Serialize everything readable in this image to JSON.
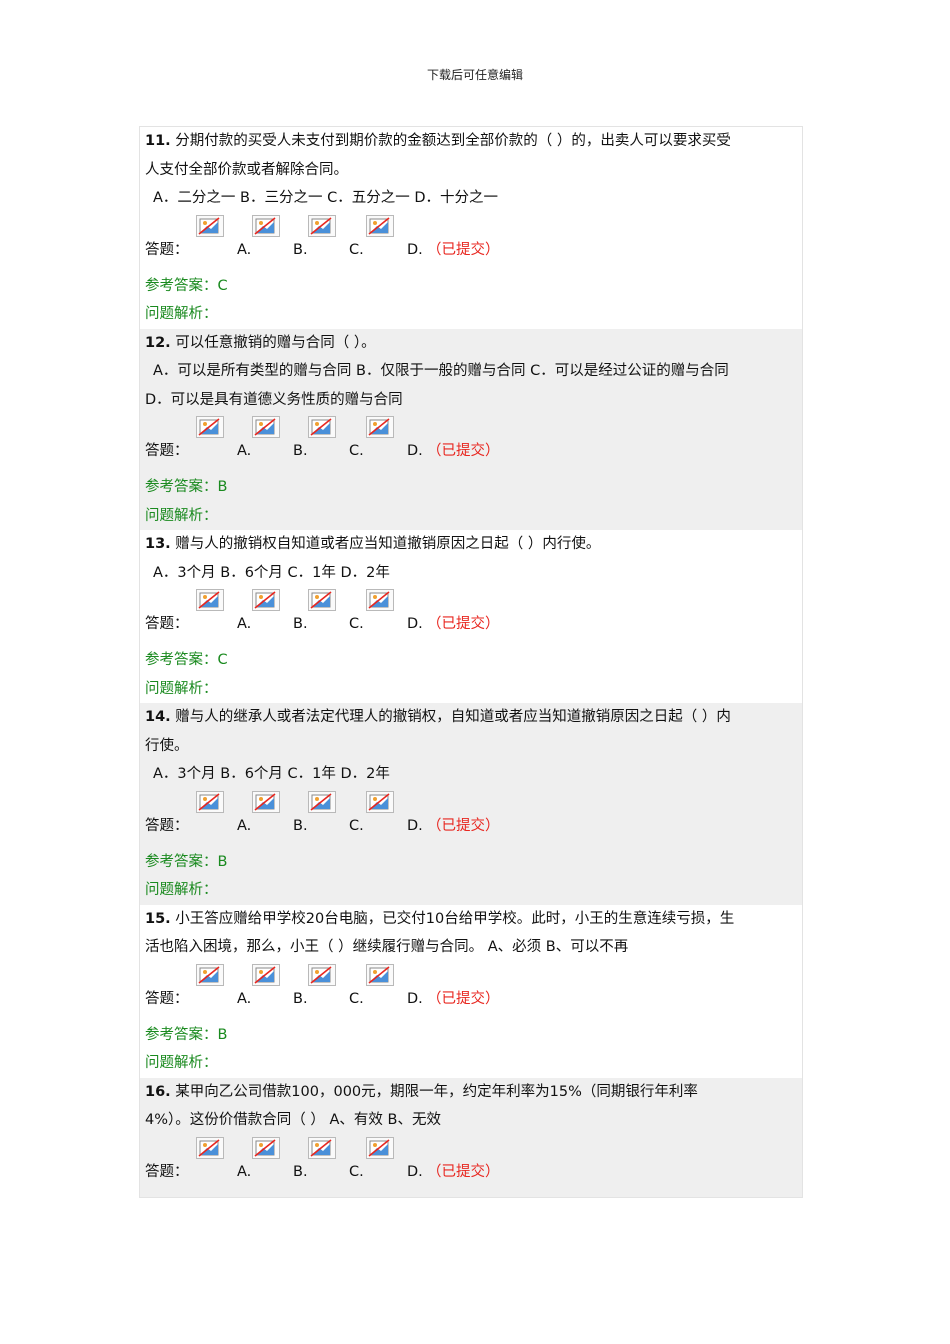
{
  "header": "下载后可任意编辑",
  "labels": {
    "answer": "答题：",
    "ref_prefix": "参考答案：",
    "analysis": "问题解析：",
    "submitted": "（已提交）",
    "choice_letters": [
      "A.",
      "B.",
      "C.",
      "D."
    ]
  },
  "questions": [
    {
      "number": "11.",
      "text_lines": [
        "分期付款的买受人未支付到期价款的金额达到全部价款的（ ）的，出卖人可以要求买受",
        "人支付全部价款或者解除合同。"
      ],
      "options_lines": [
        "A．二分之一  B．三分之一  C．五分之一  D．十分之一"
      ],
      "ref_answer": "C",
      "show_ref": true
    },
    {
      "number": "12.",
      "text_lines": [
        "可以任意撤销的赠与合同（ ）。"
      ],
      "options_lines": [
        "A．可以是所有类型的赠与合同  B．仅限于一般的赠与合同 C．可以是经过公证的赠与合同",
        "D．可以是具有道德义务性质的赠与合同"
      ],
      "ref_answer": "B",
      "show_ref": true
    },
    {
      "number": "13.",
      "text_lines": [
        "赠与人的撤销权自知道或者应当知道撤销原因之日起（ ）内行使。"
      ],
      "options_lines": [
        "A．3个月   B．6个月  C．1年 D．2年"
      ],
      "ref_answer": "C",
      "show_ref": true
    },
    {
      "number": "14.",
      "text_lines": [
        "赠与人的继承人或者法定代理人的撤销权，自知道或者应当知道撤销原因之日起（ ）内",
        "行使。"
      ],
      "options_lines": [
        "A．3个月   B．6个月  C．1年 D．2年"
      ],
      "ref_answer": "B",
      "show_ref": true
    },
    {
      "number": "15.",
      "text_lines": [
        "小王答应赠给甲学校20台电脑，已交付10台给甲学校。此时，小王的生意连续亏损，生",
        "活也陷入困境，那么，小王（ ）继续履行赠与合同。 A、必须 B、可以不再"
      ],
      "options_lines": [],
      "ref_answer": "B",
      "show_ref": true
    },
    {
      "number": "16.",
      "text_lines": [
        "某甲向乙公司借款100，000元，期限一年，约定年利率为15%（同期银行年利率",
        "4%）。这份价借款合同（ ） A、有效 B、无效"
      ],
      "options_lines": [],
      "ref_answer": "",
      "show_ref": false
    }
  ]
}
